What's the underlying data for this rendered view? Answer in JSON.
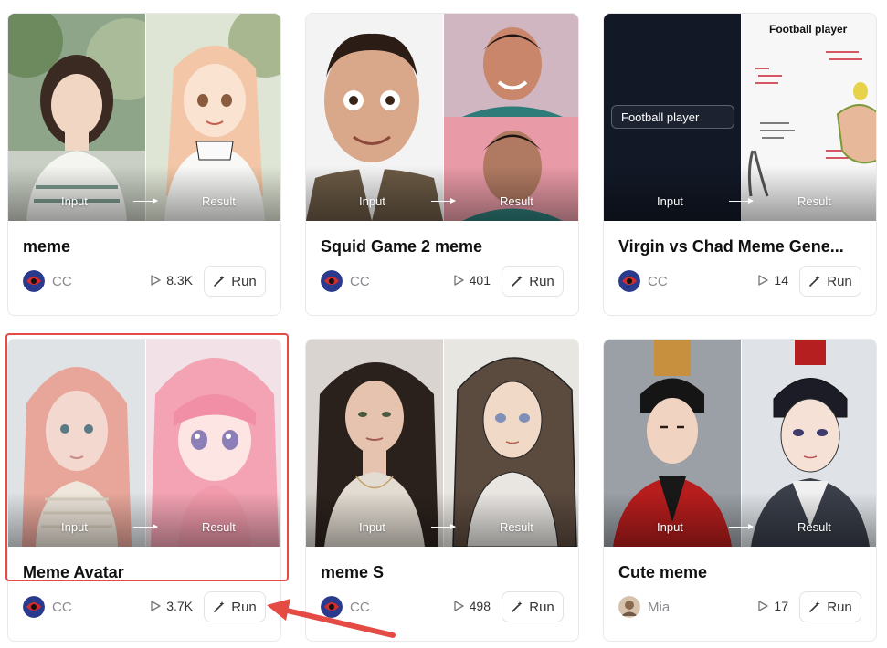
{
  "cards": [
    {
      "title": "meme",
      "author": "CC",
      "plays": "8.3K",
      "run_label": "Run",
      "input_label": "Input",
      "result_label": "Result"
    },
    {
      "title": "Squid Game 2 meme",
      "author": "CC",
      "plays": "401",
      "run_label": "Run",
      "input_label": "Input",
      "result_label": "Result"
    },
    {
      "title": "Virgin vs Chad Meme Gene...",
      "author": "CC",
      "plays": "14",
      "run_label": "Run",
      "input_label": "Input",
      "result_label": "Result",
      "input_tag": "Football player",
      "result_heading": "Football player"
    },
    {
      "title": "Meme Avatar",
      "author": "CC",
      "plays": "3.7K",
      "run_label": "Run",
      "input_label": "Input",
      "result_label": "Result"
    },
    {
      "title": "meme S",
      "author": "CC",
      "plays": "498",
      "run_label": "Run",
      "input_label": "Input",
      "result_label": "Result"
    },
    {
      "title": "Cute meme",
      "author": "Mia",
      "plays": "17",
      "run_label": "Run",
      "input_label": "Input",
      "result_label": "Result"
    }
  ],
  "annotation": {
    "highlight_color": "#e54b45",
    "arrow_color": "#e54b45"
  },
  "colors": {
    "border": "#e9e9ec",
    "muted": "#8a8a8f"
  }
}
